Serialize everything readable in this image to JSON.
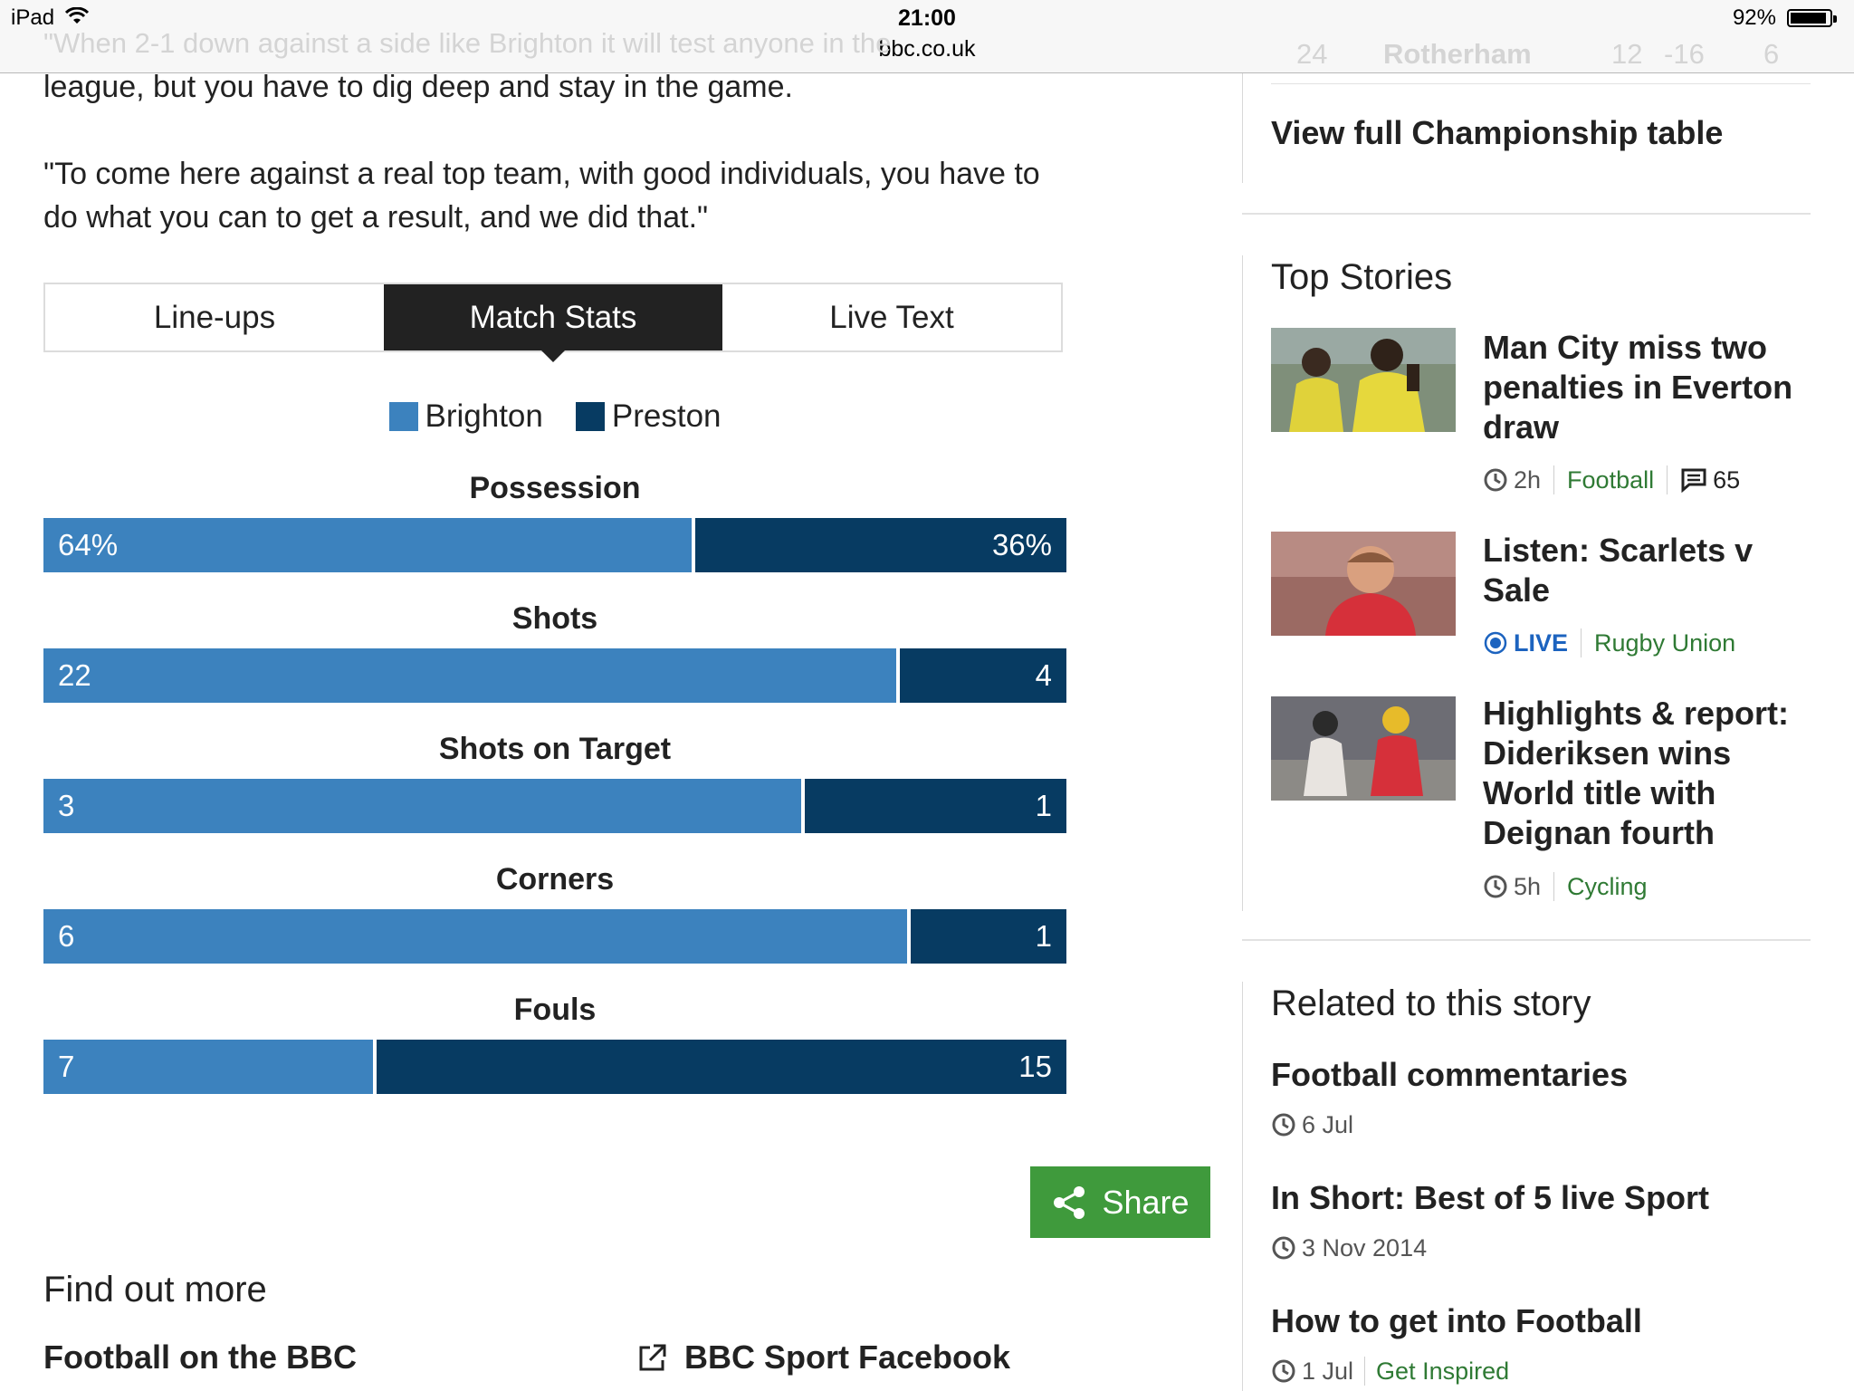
{
  "status_bar": {
    "device": "iPad",
    "time": "21:00",
    "url": "bbc.co.uk",
    "battery": "92%",
    "battery_level": 0.92
  },
  "ghost_text": {
    "quote": "\"When 2-1 down against a side like Brighton it will test anyone in the",
    "table_row": {
      "position": "24",
      "team": "Rotherham",
      "played": "12",
      "gd": "-16",
      "points": "6"
    }
  },
  "article": {
    "paragraph_1_tail": "league, but you have to dig deep and stay in the game.",
    "paragraph_2": "\"To come here against a real top team, with good individuals, you have to do what you can to get a result, and we did that.\""
  },
  "tabs": [
    {
      "label": "Line-ups",
      "active": false
    },
    {
      "label": "Match Stats",
      "active": true
    },
    {
      "label": "Live Text",
      "active": false
    }
  ],
  "legend": {
    "home": "Brighton",
    "away": "Preston"
  },
  "colors": {
    "home": "#3c82be",
    "away": "#073b62",
    "green": "#3f9a3c",
    "tag_green": "#2f7a34"
  },
  "stats": [
    {
      "name": "Possession",
      "home_label": "64%",
      "away_label": "36%",
      "home": 64,
      "away": 36
    },
    {
      "name": "Shots",
      "home_label": "22",
      "away_label": "4",
      "home": 22,
      "away": 4
    },
    {
      "name": "Shots on Target",
      "home_label": "3",
      "away_label": "1",
      "home": 3,
      "away": 1
    },
    {
      "name": "Corners",
      "home_label": "6",
      "away_label": "1",
      "home": 6,
      "away": 1
    },
    {
      "name": "Fouls",
      "home_label": "7",
      "away_label": "15",
      "home": 7,
      "away": 15
    }
  ],
  "share": {
    "label": "Share",
    "icon": "share-icon"
  },
  "find_out_more": {
    "title": "Find out more",
    "links": [
      {
        "label": "Football on the BBC"
      },
      {
        "label": "BBC Sport Facebook",
        "icon": "external-link-icon"
      }
    ]
  },
  "sidebar": {
    "view_table": "View full Championship table",
    "top_stories_title": "Top Stories",
    "stories": [
      {
        "headline": "Man City miss two penalties in Everton draw",
        "time": "2h",
        "tag": "Football",
        "comments": "65"
      },
      {
        "headline": "Listen: Scarlets v Sale",
        "live": "LIVE",
        "tag": "Rugby Union"
      },
      {
        "headline": "Highlights & report: Dideriksen wins World title with Deignan fourth",
        "time": "5h",
        "tag": "Cycling"
      }
    ],
    "related_title": "Related to this story",
    "related": [
      {
        "headline": "Football commentaries",
        "date": "6 Jul"
      },
      {
        "headline": "In Short: Best of 5 live Sport",
        "date": "3 Nov 2014"
      },
      {
        "headline": "How to get into Football",
        "date": "1 Jul",
        "tag": "Get Inspired"
      }
    ]
  }
}
